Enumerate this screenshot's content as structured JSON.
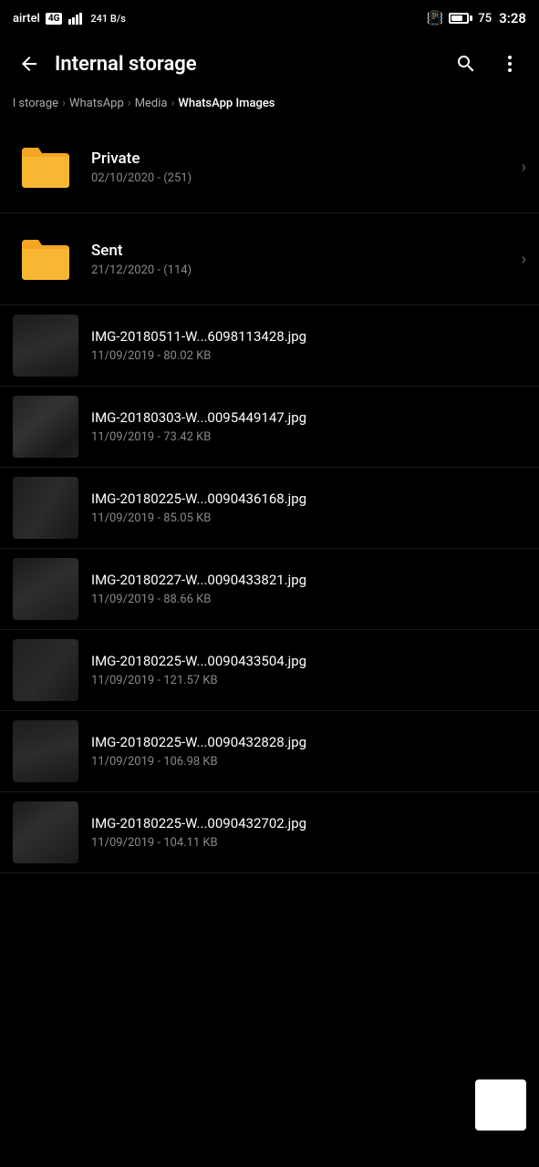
{
  "status_bar": {
    "carrier": "airtel",
    "network_type": "4G",
    "data_speed": "241 B/s",
    "battery_level": 75,
    "time": "3:28"
  },
  "nav": {
    "title": "Internal storage",
    "back_icon": "back-arrow",
    "search_icon": "search",
    "more_icon": "more-vertical"
  },
  "breadcrumb": {
    "items": [
      {
        "label": "l storage",
        "active": false
      },
      {
        "label": "WhatsApp",
        "active": false
      },
      {
        "label": "Media",
        "active": false
      },
      {
        "label": "WhatsApp Images",
        "active": true
      }
    ]
  },
  "folders": [
    {
      "name": "Private",
      "meta": "02/10/2020 - (251)"
    },
    {
      "name": "Sent",
      "meta": "21/12/2020 - (114)"
    }
  ],
  "files": [
    {
      "name": "IMG-20180511-W...6098113428.jpg",
      "meta": "11/09/2019 - 80.02 KB",
      "thumb_class": "thumb-1"
    },
    {
      "name": "IMG-20180303-W...0095449147.jpg",
      "meta": "11/09/2019 - 73.42 KB",
      "thumb_class": "thumb-2"
    },
    {
      "name": "IMG-20180225-W...0090436168.jpg",
      "meta": "11/09/2019 - 85.05 KB",
      "thumb_class": "thumb-3"
    },
    {
      "name": "IMG-20180227-W...0090433821.jpg",
      "meta": "11/09/2019 - 88.66 KB",
      "thumb_class": "thumb-4"
    },
    {
      "name": "IMG-20180225-W...0090433504.jpg",
      "meta": "11/09/2019 - 121.57 KB",
      "thumb_class": "thumb-5"
    },
    {
      "name": "IMG-20180225-W...0090432828.jpg",
      "meta": "11/09/2019 - 106.98 KB",
      "thumb_class": "thumb-6"
    },
    {
      "name": "IMG-20180225-W...0090432702.jpg",
      "meta": "11/09/2019 - 104.11 KB",
      "thumb_class": "thumb-7"
    }
  ],
  "labels": {
    "chevron": "›",
    "folder_color": "#F5A623"
  }
}
